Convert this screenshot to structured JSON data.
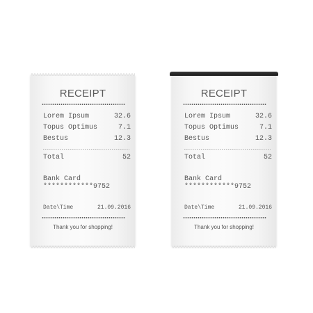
{
  "receipts": [
    {
      "title": "RECEIPT",
      "items": [
        {
          "name": "Lorem Ipsum",
          "price": "32.6"
        },
        {
          "name": "Topus Optimus",
          "price": "7.1"
        },
        {
          "name": "Bestus",
          "price": "12.3"
        }
      ],
      "total_label": "Total",
      "total_value": "52",
      "payment_method": "Bank Card",
      "card_number": "************9752",
      "datetime_label": "Date\\Time",
      "date": "21.09.2016",
      "thanks": "Thank you for shopping!"
    },
    {
      "title": "RECEIPT",
      "items": [
        {
          "name": "Lorem Ipsum",
          "price": "32.6"
        },
        {
          "name": "Topus Optimus",
          "price": "7.1"
        },
        {
          "name": "Bestus",
          "price": "12.3"
        }
      ],
      "total_label": "Total",
      "total_value": "52",
      "payment_method": "Bank Card",
      "card_number": "************9752",
      "datetime_label": "Date\\Time",
      "date": "21.09.2016",
      "thanks": "Thank you for shopping!"
    }
  ]
}
